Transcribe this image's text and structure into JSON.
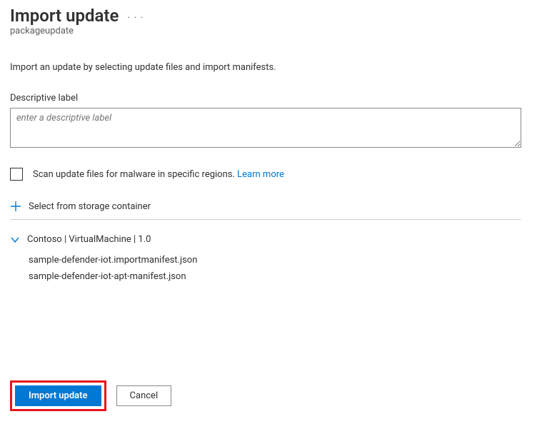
{
  "header": {
    "title": "Import update",
    "subtitle": "packageupdate"
  },
  "intro": "Import an update by selecting update files and import manifests.",
  "form": {
    "descriptive_label": "Descriptive label",
    "descriptive_placeholder": "enter a descriptive label",
    "scan_label": "Scan update files for malware in specific regions.",
    "learn_more": "Learn more"
  },
  "storage": {
    "select_label": "Select from storage container"
  },
  "tree": {
    "node_label": "Contoso | VirtualMachine | 1.0",
    "files": [
      "sample-defender-iot.importmanifest.json",
      "sample-defender-iot-apt-manifest.json"
    ]
  },
  "footer": {
    "import_label": "Import update",
    "cancel_label": "Cancel"
  }
}
